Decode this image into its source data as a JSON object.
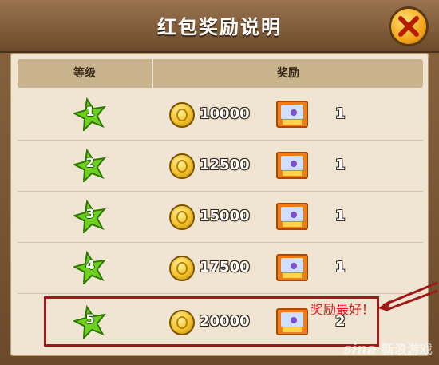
{
  "dialog": {
    "title": "红包奖励说明",
    "close_icon": "close-x-icon"
  },
  "table": {
    "headers": {
      "level": "等级",
      "reward": "奖励"
    },
    "rows": [
      {
        "level": "1",
        "coins": "10000",
        "ticket_qty": "1"
      },
      {
        "level": "2",
        "coins": "12500",
        "ticket_qty": "1"
      },
      {
        "level": "3",
        "coins": "15000",
        "ticket_qty": "1"
      },
      {
        "level": "4",
        "coins": "17500",
        "ticket_qty": "1"
      },
      {
        "level": "5",
        "coins": "20000",
        "ticket_qty": "2"
      }
    ]
  },
  "annotation": {
    "text": "奖励最好！"
  },
  "watermark": {
    "logo": "sina",
    "text": "新浪游戏"
  },
  "colors": {
    "panel": "#efe5d2",
    "header": "#c8b38c",
    "highlight": "#a01818",
    "star": "#6fd11d",
    "coin": "#f1c12a"
  }
}
